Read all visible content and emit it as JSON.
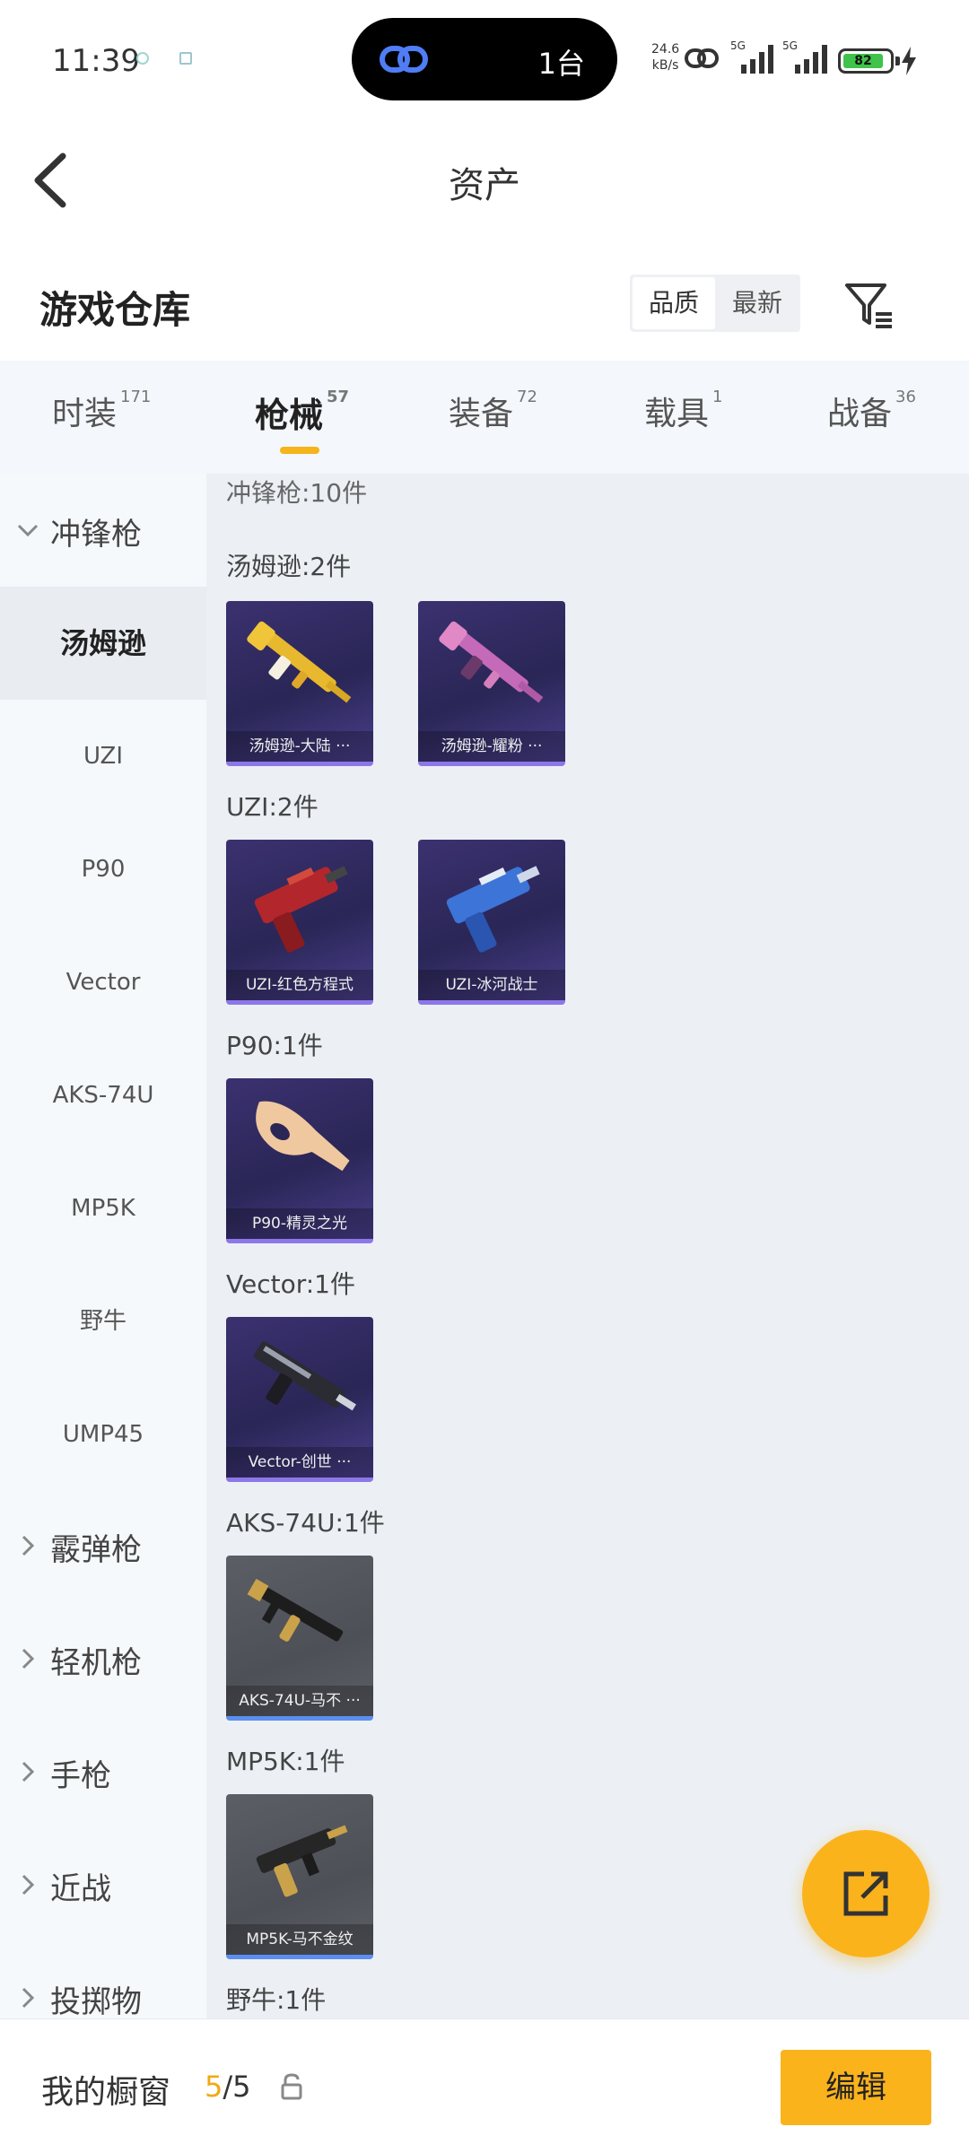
{
  "status_bar": {
    "time": "11:39",
    "island_text": "1台",
    "net_speed_value": "24.6",
    "net_speed_unit": "kB/s",
    "signal_1": "5G",
    "signal_2": "5G",
    "battery": "82"
  },
  "header": {
    "title": "资产"
  },
  "warehouse": {
    "title": "游戏仓库",
    "sort_options": [
      "品质",
      "最新"
    ],
    "active_sort": "品质"
  },
  "tabs": [
    {
      "label": "时装",
      "count": "171"
    },
    {
      "label": "枪械",
      "count": "57"
    },
    {
      "label": "装备",
      "count": "72"
    },
    {
      "label": "载具",
      "count": "1"
    },
    {
      "label": "战备",
      "count": "36"
    }
  ],
  "active_tab": "枪械",
  "sidebar": {
    "group_open": "冲锋枪",
    "items": [
      "汤姆逊",
      "UZI",
      "P90",
      "Vector",
      "AKS-74U",
      "MP5K",
      "野牛",
      "UMP45"
    ],
    "active_item": "汤姆逊",
    "groups_closed": [
      "霰弹枪",
      "轻机枪",
      "手枪",
      "近战",
      "投掷物"
    ]
  },
  "content": {
    "top_label": "冲锋枪:10件",
    "sections": [
      {
        "label": "汤姆逊:2件",
        "items": [
          {
            "name": "汤姆逊-大陆 ···",
            "rarity": "purple"
          },
          {
            "name": "汤姆逊-耀粉 ···",
            "rarity": "purple"
          }
        ]
      },
      {
        "label": "UZI:2件",
        "items": [
          {
            "name": "UZI-红色方程式",
            "rarity": "purple"
          },
          {
            "name": "UZI-冰河战士",
            "rarity": "purple"
          }
        ]
      },
      {
        "label": "P90:1件",
        "items": [
          {
            "name": "P90-精灵之光",
            "rarity": "purple"
          }
        ]
      },
      {
        "label": "Vector:1件",
        "items": [
          {
            "name": "Vector-创世 ···",
            "rarity": "purple"
          }
        ]
      },
      {
        "label": "AKS-74U:1件",
        "items": [
          {
            "name": "AKS-74U-马不 ···",
            "rarity": "gray"
          }
        ]
      },
      {
        "label": "MP5K:1件",
        "items": [
          {
            "name": "MP5K-马不金纹",
            "rarity": "gray"
          }
        ]
      },
      {
        "label": "野牛:1件",
        "items": []
      }
    ]
  },
  "bottom_bar": {
    "label": "我的橱窗",
    "count_current": "5",
    "count_separator": "/",
    "count_total": "5",
    "edit_label": "编辑"
  },
  "colors": {
    "accent": "#fbb31c",
    "card_purple": "#2a2656",
    "card_gray": "#4e5058",
    "sidebar_bg": "#f6f9fc",
    "content_bg": "#ecf0f5"
  }
}
